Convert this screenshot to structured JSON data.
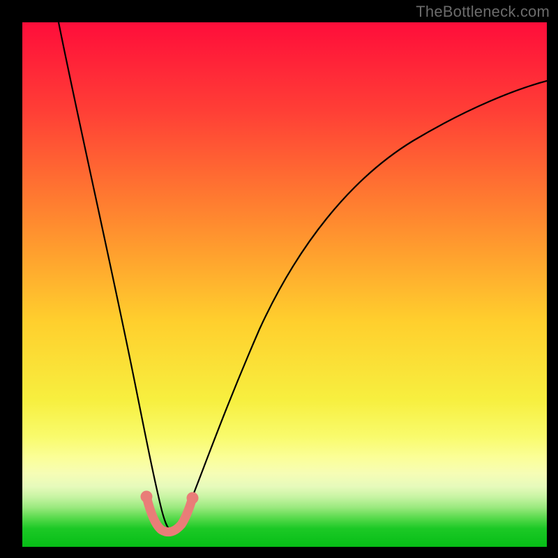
{
  "watermark": "TheBottleneck.com",
  "chart_data": {
    "type": "line",
    "title": "",
    "xlabel": "",
    "ylabel": "",
    "xlim": [
      0,
      100
    ],
    "ylim": [
      0,
      100
    ],
    "background_gradient": {
      "stops": [
        {
          "pos": 0,
          "color": "#ff0d3a"
        },
        {
          "pos": 17,
          "color": "#ff3f36"
        },
        {
          "pos": 38,
          "color": "#ff8a2f"
        },
        {
          "pos": 57,
          "color": "#ffcf2d"
        },
        {
          "pos": 72,
          "color": "#f7ef3f"
        },
        {
          "pos": 79,
          "color": "#f9fb6c"
        },
        {
          "pos": 83,
          "color": "#fbfe98"
        },
        {
          "pos": 86,
          "color": "#f6fdb5"
        },
        {
          "pos": 88.5,
          "color": "#e6fabb"
        },
        {
          "pos": 90.5,
          "color": "#c7f4a3"
        },
        {
          "pos": 92.5,
          "color": "#9ae97e"
        },
        {
          "pos": 94.5,
          "color": "#58da4c"
        },
        {
          "pos": 96.5,
          "color": "#1cc926"
        },
        {
          "pos": 100,
          "color": "#06be16"
        }
      ]
    },
    "series": [
      {
        "name": "bottleneck-curve",
        "color": "#000000",
        "x": [
          7,
          10,
          14,
          17,
          20,
          23,
          25,
          27,
          30,
          33,
          37,
          42,
          48,
          55,
          63,
          72,
          81,
          90,
          100
        ],
        "y": [
          100,
          85,
          68,
          51,
          35,
          20,
          8,
          3,
          3,
          8,
          20,
          35,
          48,
          58,
          66,
          72,
          76.5,
          80,
          83
        ]
      }
    ],
    "highlight_segment": {
      "color": "#e97d78",
      "x": [
        23.5,
        24.6,
        25.8,
        27.2,
        28.5,
        29.8,
        31.2,
        32.2
      ],
      "y": [
        8.8,
        6.0,
        4.2,
        3.3,
        3.3,
        4.2,
        6.0,
        8.8
      ]
    }
  }
}
